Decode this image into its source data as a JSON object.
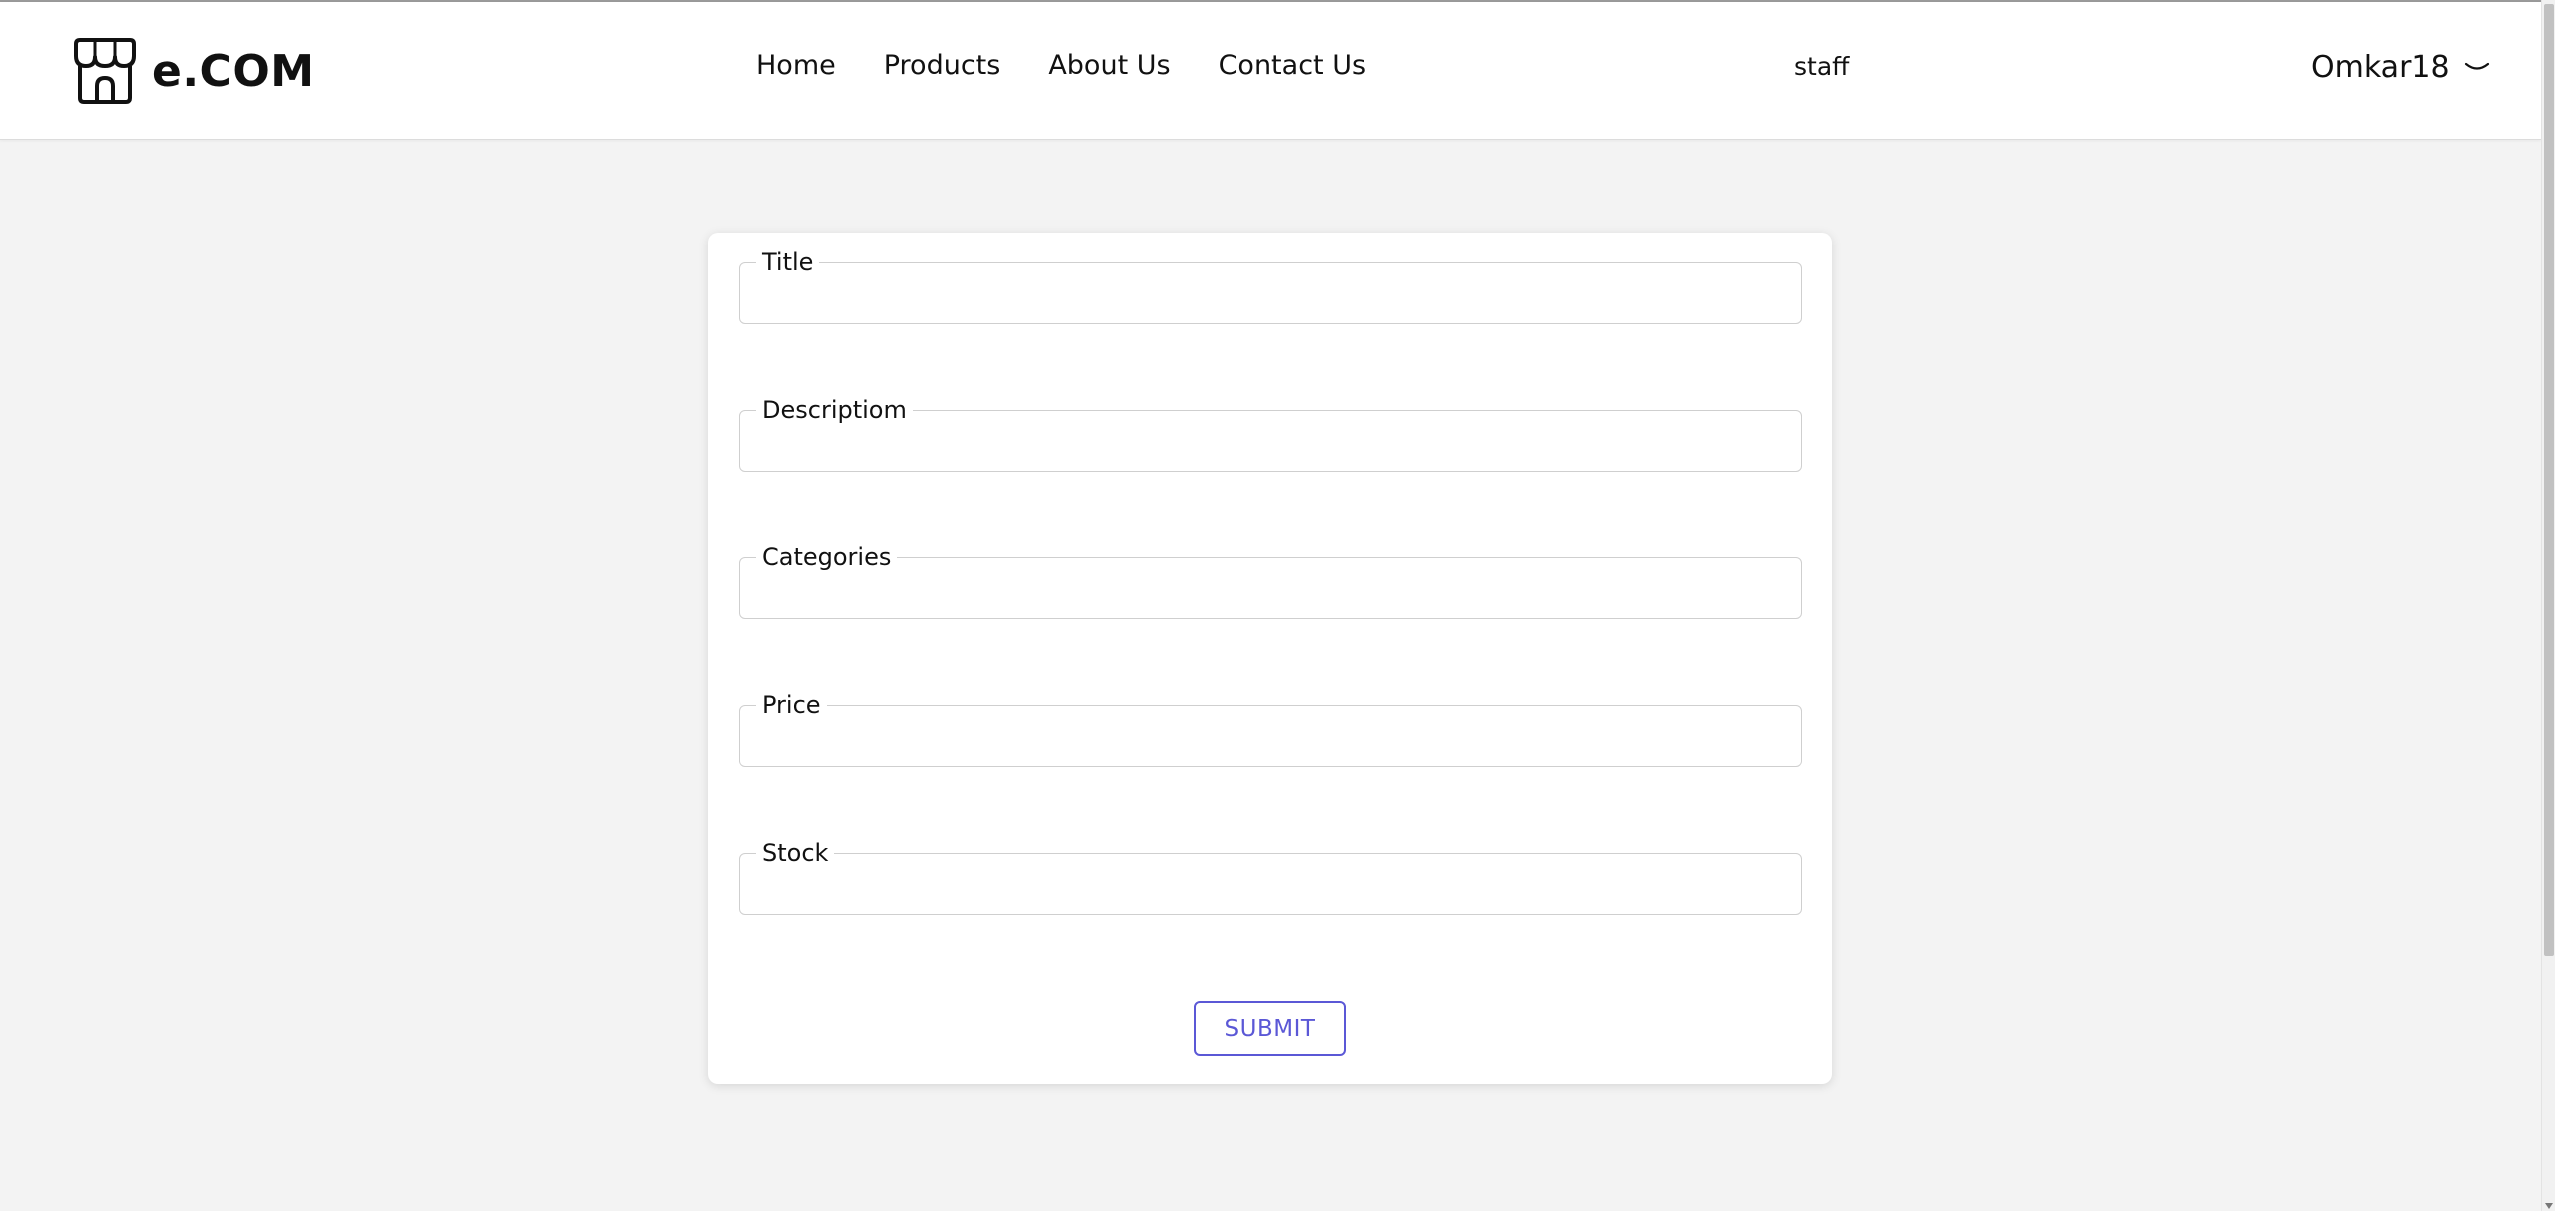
{
  "brand": {
    "name": "e.COM",
    "icon": "store-icon"
  },
  "nav": {
    "items": [
      {
        "label": "Home"
      },
      {
        "label": "Products"
      },
      {
        "label": "About Us"
      },
      {
        "label": "Contact Us"
      }
    ]
  },
  "header": {
    "role": "staff",
    "user_name": "Omkar18",
    "user_menu_icon": "chevron-down-icon"
  },
  "form": {
    "fields": [
      {
        "label": "Title",
        "value": ""
      },
      {
        "label": "Descriptiom",
        "value": ""
      },
      {
        "label": "Categories",
        "value": ""
      },
      {
        "label": "Price",
        "value": ""
      },
      {
        "label": "Stock",
        "value": ""
      }
    ],
    "submit_label": "SUBMIT"
  },
  "colors": {
    "accent": "#5b58d6",
    "background": "#f3f3f3",
    "card": "#ffffff"
  }
}
